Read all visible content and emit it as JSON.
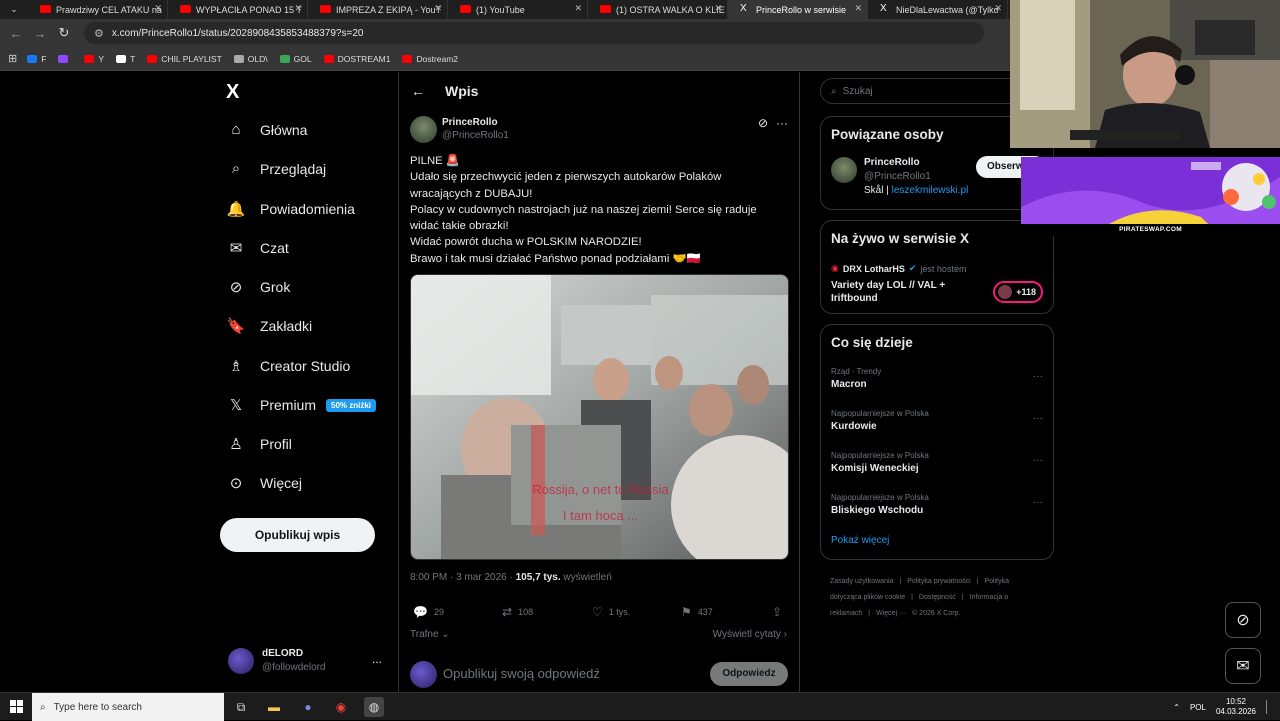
{
  "browser": {
    "tabs": [
      {
        "title": "Prawdziwy CEL ATAKU na",
        "type": "yt"
      },
      {
        "title": "WYPŁACIŁA PONAD 15 T",
        "type": "yt"
      },
      {
        "title": "IMPREZA Z EKIPĄ - YouT",
        "type": "yt"
      },
      {
        "title": "(1) YouTube",
        "type": "yt"
      },
      {
        "title": "(1) OSTRA WALKA O KLIE",
        "type": "yt"
      },
      {
        "title": "PrinceRollo w serwisie",
        "type": "x",
        "active": true
      },
      {
        "title": "NieDlaLewactwa (@Tylko",
        "type": "x"
      }
    ],
    "url": "x.com/PrinceRollo1/status/2028908435853488379?s=20",
    "bookmarks": [
      {
        "label": "F",
        "color": "#1877f2"
      },
      {
        "label": "",
        "color": "#9146ff"
      },
      {
        "label": "Y",
        "color": "#ff0000"
      },
      {
        "label": "T",
        "color": "#ffffff"
      },
      {
        "label": "CHIL PLAYLIST",
        "color": "#ff0000"
      },
      {
        "label": "OLD\\",
        "color": "#aaaaaa"
      },
      {
        "label": "GOL",
        "color": "#3aa757"
      },
      {
        "label": "DOSTREAM1",
        "color": "#ff0000"
      },
      {
        "label": "Dostream2",
        "color": "#ff0000"
      }
    ]
  },
  "nav": {
    "logo": "X",
    "items": [
      {
        "label": "Główna",
        "icon": "home-icon",
        "glyph": "⌂"
      },
      {
        "label": "Przeglądaj",
        "icon": "search-icon",
        "glyph": "⌕"
      },
      {
        "label": "Powiadomienia",
        "icon": "bell-icon",
        "glyph": "🔔"
      },
      {
        "label": "Czat",
        "icon": "envelope-icon",
        "glyph": "✉"
      },
      {
        "label": "Grok",
        "icon": "grok-icon",
        "glyph": "⊘"
      },
      {
        "label": "Zakładki",
        "icon": "bookmark-icon",
        "glyph": "🔖"
      },
      {
        "label": "Creator Studio",
        "icon": "creator-icon",
        "glyph": "♗"
      },
      {
        "label": "Premium",
        "icon": "x-premium-icon",
        "glyph": "𝕏",
        "badge": "50% zniżki"
      },
      {
        "label": "Profil",
        "icon": "profile-icon",
        "glyph": "♙"
      },
      {
        "label": "Więcej",
        "icon": "more-circle-icon",
        "glyph": "⊙"
      }
    ],
    "post_button": "Opublikuj wpis",
    "account": {
      "name": "dELORD",
      "handle": "@followdelord",
      "more": "..."
    }
  },
  "feed": {
    "header_title": "Wpis",
    "author": {
      "name": "PrinceRollo",
      "handle": "@PrinceRollo1"
    },
    "text_lines": [
      "PILNE 🚨",
      "Udało się przechwycić jeden z pierwszych autokarów Polaków",
      "wracających z DUBAJU!",
      "Polacy w cudownych nastrojach już na naszej ziemi! Serce się raduje",
      "widać takie obrazki!",
      "Widać powrót ducha w POLSKIM NARODZIE!",
      "Brawo i tak musi działać Państwo ponad podziałami 🤝🇵🇱"
    ],
    "video_caption_line1": "Rossija, o net to Russia",
    "video_caption_line2": "I tam hoca ...",
    "meta": {
      "time": "8:00 PM · 3 mar 2026 · ",
      "views": "105,7 tys.",
      "views_label": " wyświetleń"
    },
    "actions": {
      "replies": "29",
      "reposts": "108",
      "likes": "1 tys.",
      "bookmarks": "437"
    },
    "relevance": "Trafne",
    "quotes": "Wyświetl cytaty",
    "reply_placeholder": "Opublikuj swoją odpowiedź",
    "reply_button": "Odpowiedz"
  },
  "right": {
    "search_placeholder": "Szukaj",
    "related": {
      "title": "Powiązane osoby",
      "name": "PrinceRollo",
      "handle": "@PrinceRollo1",
      "bio_prefix": "Skål | ",
      "bio_link": "leszekmilewski.pl",
      "follow": "Obserwuj"
    },
    "live": {
      "title": "Na żywo w serwisie X",
      "host_name": "DRX LotharHS",
      "host_suffix": "jest hostem",
      "stream_title": "Variety day LOL // VAL + Iriftbound",
      "count": "+118"
    },
    "trends": {
      "title": "Co się dzieje",
      "items": [
        {
          "context": "Rząd · Trendy",
          "name": "Macron"
        },
        {
          "context": "Najpopularniejsze w Polska",
          "name": "Kurdowie"
        },
        {
          "context": "Najpopularniejsze w Polska",
          "name": "Komisji Weneckiej"
        },
        {
          "context": "Najpopularniejsze w Polska",
          "name": "Bliskiego Wschodu"
        }
      ],
      "show_more": "Pokaż więcej"
    },
    "footer": [
      "Zasady użytkowania",
      "|",
      "Polityka prywatności",
      "|",
      "Polityka dotycząca plików cookie",
      "|",
      "Dostępność",
      "|",
      "Informacja o reklamach",
      "|",
      "Więcej ···",
      "© 2026 X Corp."
    ]
  },
  "overlay": {
    "promo_label": "PIRATESWAP.COM"
  },
  "taskbar": {
    "search_placeholder": "Type here to search",
    "lang": "POL",
    "time": "10:52",
    "date": "04.03.2026"
  }
}
